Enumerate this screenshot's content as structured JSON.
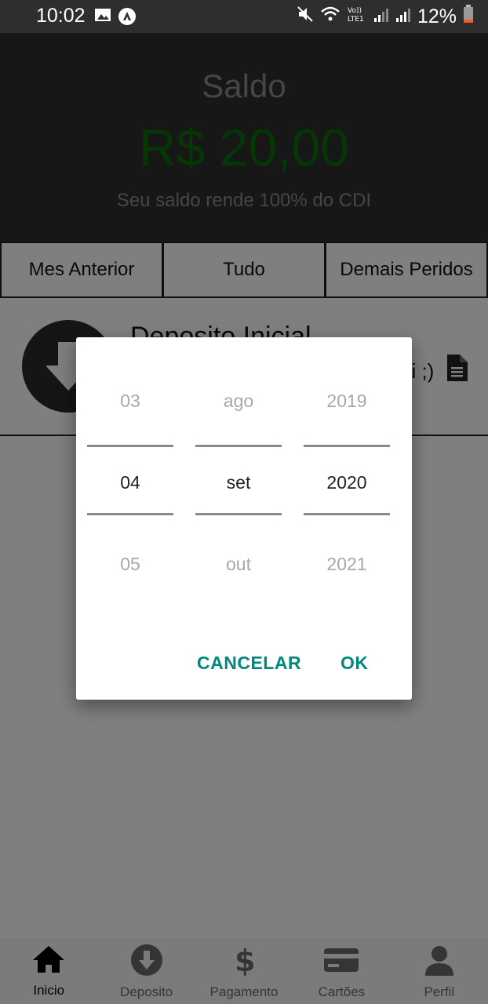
{
  "status_bar": {
    "time": "10:02",
    "battery": "12%",
    "left_icons": [
      "image-icon",
      "app-icon"
    ],
    "right_icons": [
      "mute-icon",
      "wifi-icon",
      "volte-icon",
      "signal-icon",
      "signal-icon",
      "battery-icon"
    ]
  },
  "header": {
    "label": "Saldo",
    "amount": "R$ 20,00",
    "note": "Seu saldo rende 100% do CDI",
    "amount_color": "#0b6e0b"
  },
  "tabs": [
    "Mes Anterior",
    "Tudo",
    "Demais Peridos"
  ],
  "transaction": {
    "title": "Deposito Inicial",
    "subtitle": "ui ;)"
  },
  "date_picker": {
    "day": {
      "prev": "03",
      "selected": "04",
      "next": "05"
    },
    "month": {
      "prev": "ago",
      "selected": "set",
      "next": "out"
    },
    "year": {
      "prev": "2019",
      "selected": "2020",
      "next": "2021"
    },
    "cancel_label": "CANCELAR",
    "ok_label": "OK",
    "accent_color": "#00897b"
  },
  "bottom_nav": {
    "items": [
      {
        "label": "Inicio",
        "icon": "home-icon",
        "active": true
      },
      {
        "label": "Deposito",
        "icon": "deposit-arrow-icon",
        "active": false
      },
      {
        "label": "Pagamento",
        "icon": "dollar-icon",
        "active": false
      },
      {
        "label": "Cartões",
        "icon": "card-icon",
        "active": false
      },
      {
        "label": "Perfil",
        "icon": "user-icon",
        "active": false
      }
    ]
  }
}
